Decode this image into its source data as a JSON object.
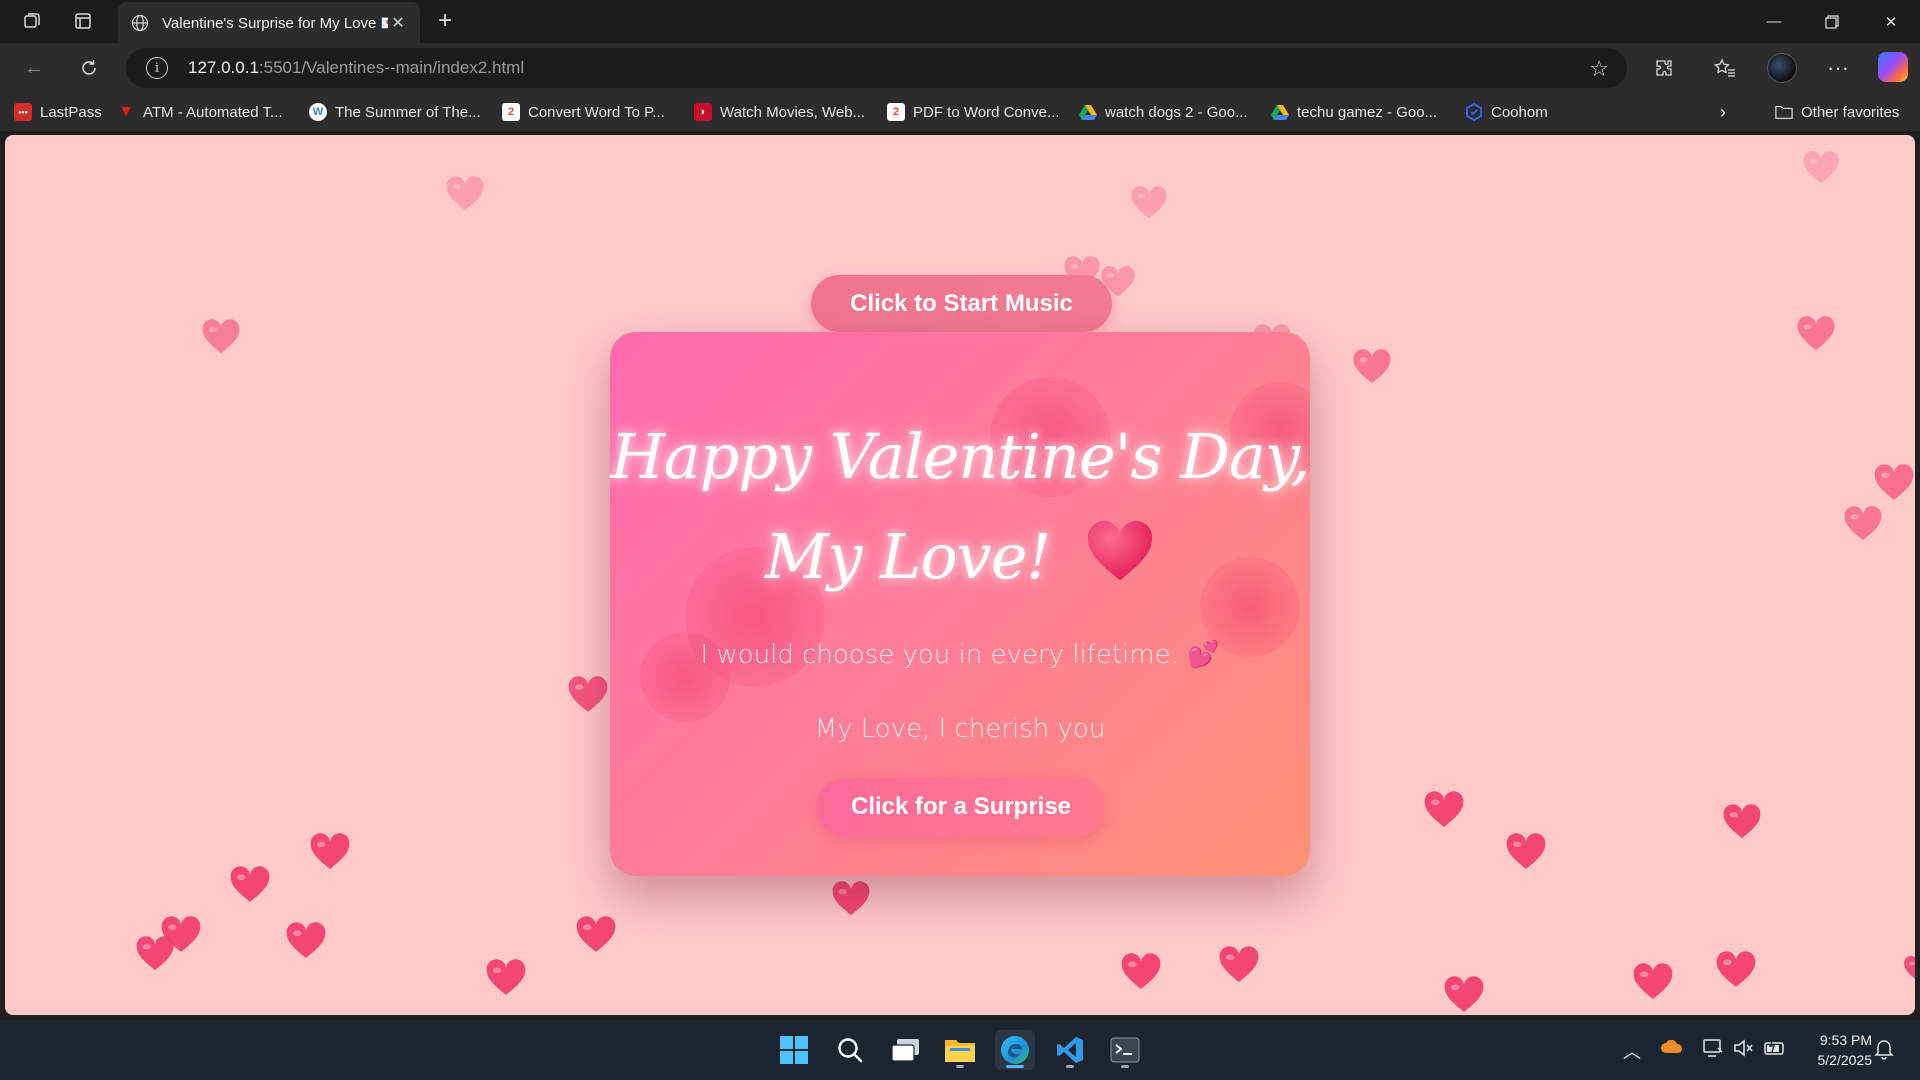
{
  "browser": {
    "tab_title": "Valentine's Surprise for My Love 💌",
    "url_host": "127.0.0.1",
    "url_rest": ":5501/Valentines--main/index2.html",
    "bookmarks": [
      {
        "label": "LastPass",
        "color": "#d32d27"
      },
      {
        "label": "ATM - Automated T...",
        "color": "#e02020"
      },
      {
        "label": "The Summer of The...",
        "color": "#3b82c4"
      },
      {
        "label": "Convert Word To P...",
        "color": "#e0463c"
      },
      {
        "label": "Watch Movies, Web...",
        "color": "#c8102e"
      },
      {
        "label": "PDF to Word Conve...",
        "color": "#e0463c"
      },
      {
        "label": "watch dogs 2 - Goo...",
        "color": "#1fa463"
      },
      {
        "label": "techu gamez - Goo...",
        "color": "#1fa463"
      },
      {
        "label": "Coohom",
        "color": "#2f6bff"
      }
    ],
    "other_favorites": "Other favorites"
  },
  "page": {
    "music_button": "Click to Start Music",
    "title_line1": "Happy Valentine's Day,",
    "title_line2": "My Love!",
    "message_1": "I would choose you in every lifetime. 💕",
    "message_2": "My Love, I cherish you",
    "surprise_button": "Click for a Surprise",
    "colors": {
      "background": "#ffc9c8",
      "heart": "#f4406e",
      "card_start": "#ff6aac",
      "card_end": "#ff9176"
    }
  },
  "taskbar": {
    "time": "9:53 PM",
    "date": "5/2/2025",
    "apps": [
      "windows-start-icon",
      "search-icon",
      "task-view-icon",
      "file-explorer-icon",
      "edge-icon",
      "vscode-icon",
      "terminal-icon"
    ]
  }
}
